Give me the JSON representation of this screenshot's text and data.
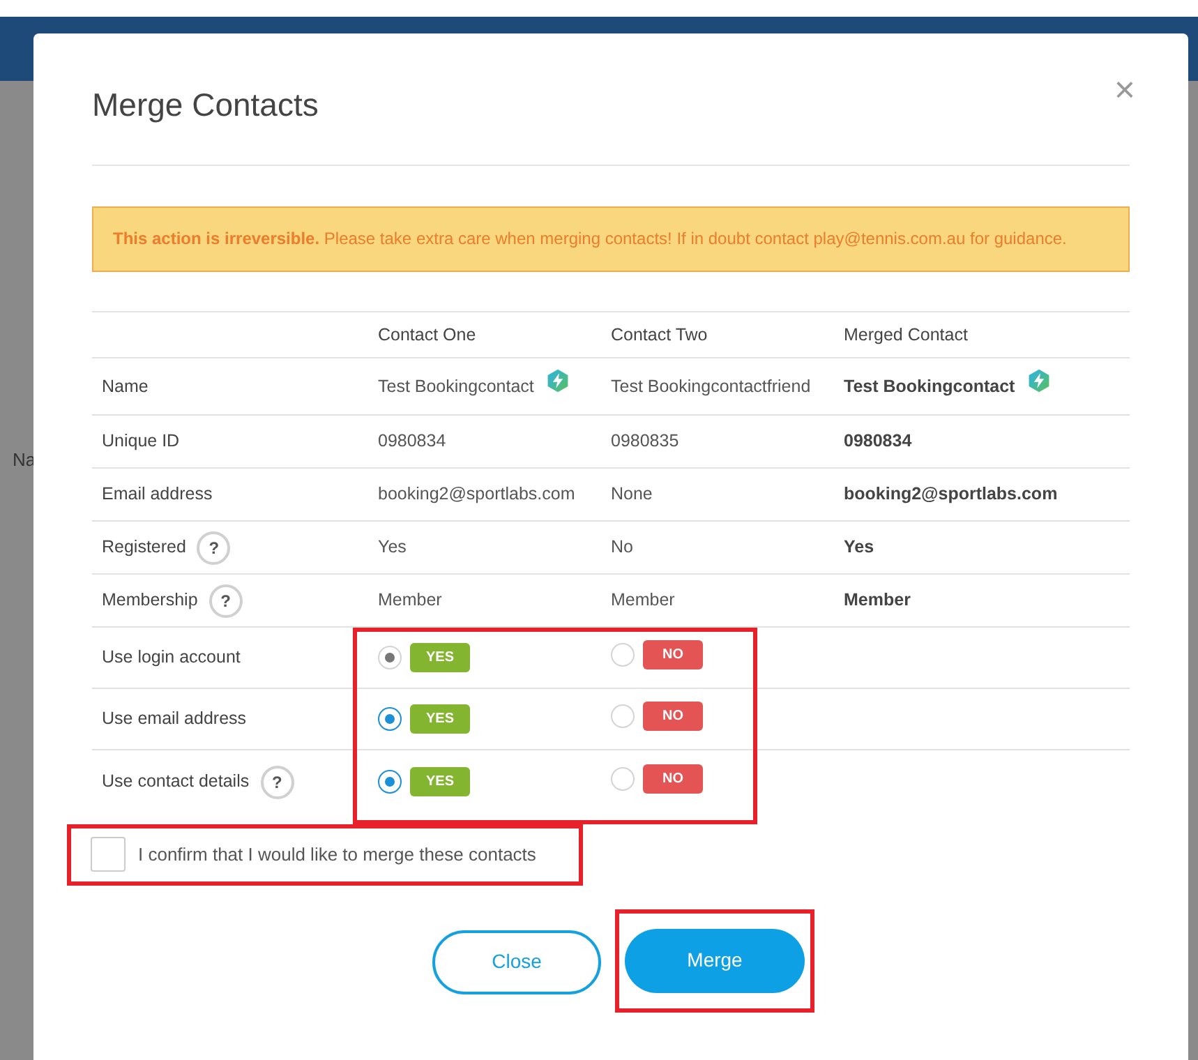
{
  "background": {
    "column_fragment": "Na"
  },
  "dialog": {
    "title": "Merge Contacts",
    "close": "×",
    "warning": "**This action is irreversible.** Please take extra care when merging contacts! If in doubt contact play@tennis.com.au for guidance.",
    "columns": [
      "Contact One",
      "Contact Two",
      "Merged Contact"
    ],
    "rows": [
      {
        "kind": "text",
        "label": "Name",
        "cells": [
          {
            "text": "Test Bookingcontact",
            "badge": true
          },
          {
            "text": "Test Bookingcontactfriend"
          }
        ],
        "merged": {
          "text": "Test Bookingcontact",
          "badge": true
        }
      },
      {
        "kind": "text",
        "label": "Unique ID",
        "cells": [
          {
            "text": "0980834"
          },
          {
            "text": "0980835"
          }
        ],
        "merged": {
          "text": "0980834"
        }
      },
      {
        "kind": "text",
        "label": "Email address",
        "cells": [
          {
            "text": "booking2@sportlabs.com"
          },
          {
            "text": "None"
          }
        ],
        "merged": {
          "text": "booking2@sportlabs.com"
        }
      },
      {
        "kind": "text",
        "label": "Registered",
        "help": "?",
        "cells": [
          {
            "text": "Yes"
          },
          {
            "text": "No"
          }
        ],
        "merged": {
          "text": "Yes"
        }
      },
      {
        "kind": "text",
        "label": "Membership",
        "help": "?",
        "cells": [
          {
            "text": "Member"
          },
          {
            "text": "Member"
          }
        ],
        "merged": {
          "text": "Member"
        }
      },
      {
        "kind": "choice",
        "label": "Use login account",
        "options": [
          {
            "tag": "YES",
            "kind": "yes",
            "selected": true,
            "disabled": true
          },
          {
            "tag": "NO",
            "kind": "no",
            "selected": false
          }
        ]
      },
      {
        "kind": "choice",
        "label": "Use email address",
        "options": [
          {
            "tag": "YES",
            "kind": "yes",
            "selected": true
          },
          {
            "tag": "NO",
            "kind": "no",
            "selected": false
          }
        ]
      },
      {
        "kind": "choice",
        "label": "Use contact details",
        "help": "?",
        "options": [
          {
            "tag": "YES",
            "kind": "yes",
            "selected": true
          },
          {
            "tag": "NO",
            "kind": "no",
            "selected": false
          }
        ]
      }
    ],
    "confirm": {
      "label": "I confirm that I would like to merge these contacts",
      "checked": false
    },
    "buttons": [
      {
        "label": "Close",
        "kind": "outline"
      },
      {
        "label": "Merge",
        "kind": "primary"
      }
    ]
  }
}
